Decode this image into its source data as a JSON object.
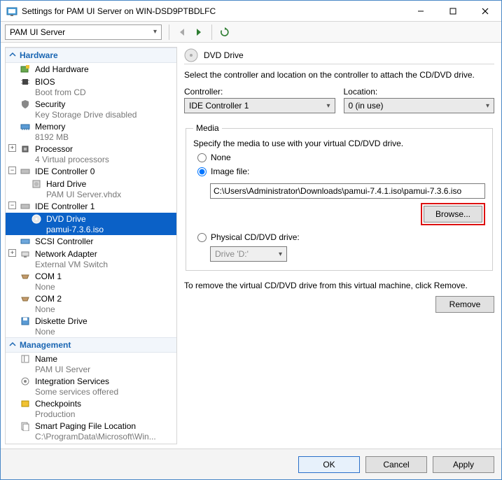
{
  "window": {
    "title": "Settings for PAM UI Server on WIN-DSD9PTBDLFC"
  },
  "toolbar": {
    "combo_value": "PAM UI Server"
  },
  "sidebar": {
    "categories": [
      {
        "label": "Hardware"
      },
      {
        "label": "Management"
      }
    ],
    "hardware": {
      "add_hardware": "Add Hardware",
      "bios": {
        "label": "BIOS",
        "sub": "Boot from CD"
      },
      "security": {
        "label": "Security",
        "sub": "Key Storage Drive disabled"
      },
      "memory": {
        "label": "Memory",
        "sub": "8192 MB"
      },
      "processor": {
        "label": "Processor",
        "sub": "4 Virtual processors"
      },
      "ide0": {
        "label": "IDE Controller 0"
      },
      "hard_drive": {
        "label": "Hard Drive",
        "sub": "PAM UI Server.vhdx"
      },
      "ide1": {
        "label": "IDE Controller 1"
      },
      "dvd": {
        "label": "DVD Drive",
        "sub": "pamui-7.3.6.iso"
      },
      "scsi": {
        "label": "SCSI Controller"
      },
      "net": {
        "label": "Network Adapter",
        "sub": "External VM Switch"
      },
      "com1": {
        "label": "COM 1",
        "sub": "None"
      },
      "com2": {
        "label": "COM 2",
        "sub": "None"
      },
      "diskette": {
        "label": "Diskette Drive",
        "sub": "None"
      }
    },
    "management": {
      "name": {
        "label": "Name",
        "sub": "PAM UI Server"
      },
      "integ": {
        "label": "Integration Services",
        "sub": "Some services offered"
      },
      "checkpoints": {
        "label": "Checkpoints",
        "sub": "Production"
      },
      "paging": {
        "label": "Smart Paging File Location",
        "sub": "C:\\ProgramData\\Microsoft\\Win..."
      }
    }
  },
  "main": {
    "header": "DVD Drive",
    "desc": "Select the controller and location on the controller to attach the CD/DVD drive.",
    "controller_label": "Controller:",
    "controller_value": "IDE Controller 1",
    "location_label": "Location:",
    "location_value": "0 (in use)",
    "media": {
      "legend": "Media",
      "desc": "Specify the media to use with your virtual CD/DVD drive.",
      "opt_none": "None",
      "opt_image": "Image file:",
      "image_path": "C:\\Users\\Administrator\\Downloads\\pamui-7.4.1.iso\\pamui-7.3.6.iso",
      "browse": "Browse...",
      "opt_physical": "Physical CD/DVD drive:",
      "physical_value": "Drive 'D:'"
    },
    "remove_desc": "To remove the virtual CD/DVD drive from this virtual machine, click Remove.",
    "remove_btn": "Remove"
  },
  "footer": {
    "ok": "OK",
    "cancel": "Cancel",
    "apply": "Apply"
  }
}
